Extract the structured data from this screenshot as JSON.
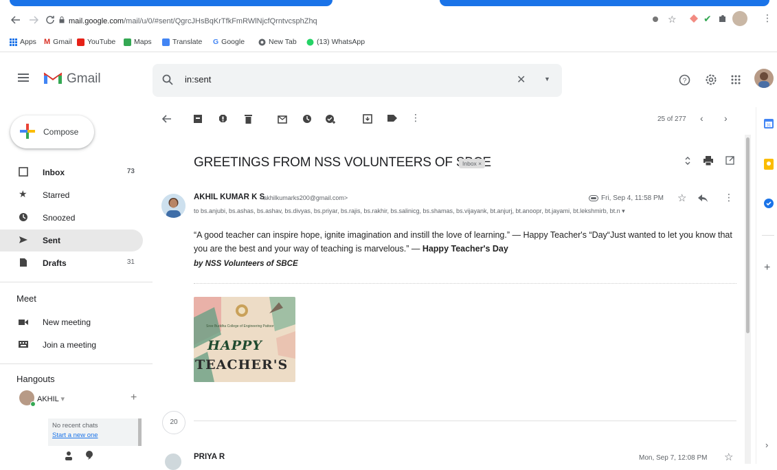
{
  "browser": {
    "url_host": "mail.google.com",
    "url_path": "/mail/u/0/#sent/QgrcJHsBqKrTfkFmRWlNjcfQrntvcsphZhq",
    "bookmarks": [
      "Apps",
      "Gmail",
      "YouTube",
      "Maps",
      "Translate",
      "Google",
      "New Tab",
      "(13) WhatsApp"
    ]
  },
  "header": {
    "app_name": "Gmail",
    "search_value": "in:sent"
  },
  "sidebar": {
    "compose_label": "Compose",
    "items": [
      {
        "label": "Inbox",
        "count": "73"
      },
      {
        "label": "Starred",
        "count": ""
      },
      {
        "label": "Snoozed",
        "count": ""
      },
      {
        "label": "Sent",
        "count": ""
      },
      {
        "label": "Drafts",
        "count": "31"
      }
    ],
    "meet_title": "Meet",
    "meet_items": [
      "New meeting",
      "Join a meeting"
    ],
    "hangouts_title": "Hangouts",
    "hangouts_user": "AKHIL",
    "hangouts_empty": "No recent chats",
    "hangouts_start": "Start a new one"
  },
  "toolbar": {
    "pager": "25 of 277"
  },
  "message": {
    "subject": "GREETINGS FROM NSS VOLUNTEERS OF SBCE",
    "label": "Inbox ×",
    "sender_name": "AKHIL KUMAR K S",
    "sender_email": "<akhilkumarks200@gmail.com>",
    "date": "Fri, Sep 4, 11:58 PM",
    "recipients": "to bs.anjubi, bs.ashas, bs.ashav, bs.divyas, bs.priyar, bs.rajis, bs.rakhir, bs.salinicg, bs.shamas, bs.vijayank, bt.anjurj, bt.anoopr, bt.jayami, bt.lekshmirb, bt.n ▾",
    "body_line_1": "“A good teacher can inspire hope, ignite imagination and instill the love of learning.” — Happy Teacher's “Day“Just wanted to let you know that",
    "body_line_2_a": "you are the best and your way of teaching is marvelous.” — ",
    "body_line_2_b": "Happy Teacher's Day",
    "signature": "by NSS Volunteers of SBCE",
    "attachment_line_1": "HAPPY",
    "attachment_line_2": "TEACHER'S",
    "attachment_caption": "Sree Buddha College of Engineering Pattoor"
  },
  "thread": {
    "collapsed_count": "20",
    "next_sender": "PRIYA R",
    "next_date": "Mon, Sep 7, 12:08 PM"
  },
  "colors": {
    "accent": "#1a73e8",
    "active_nav": "#e8e8e8"
  }
}
